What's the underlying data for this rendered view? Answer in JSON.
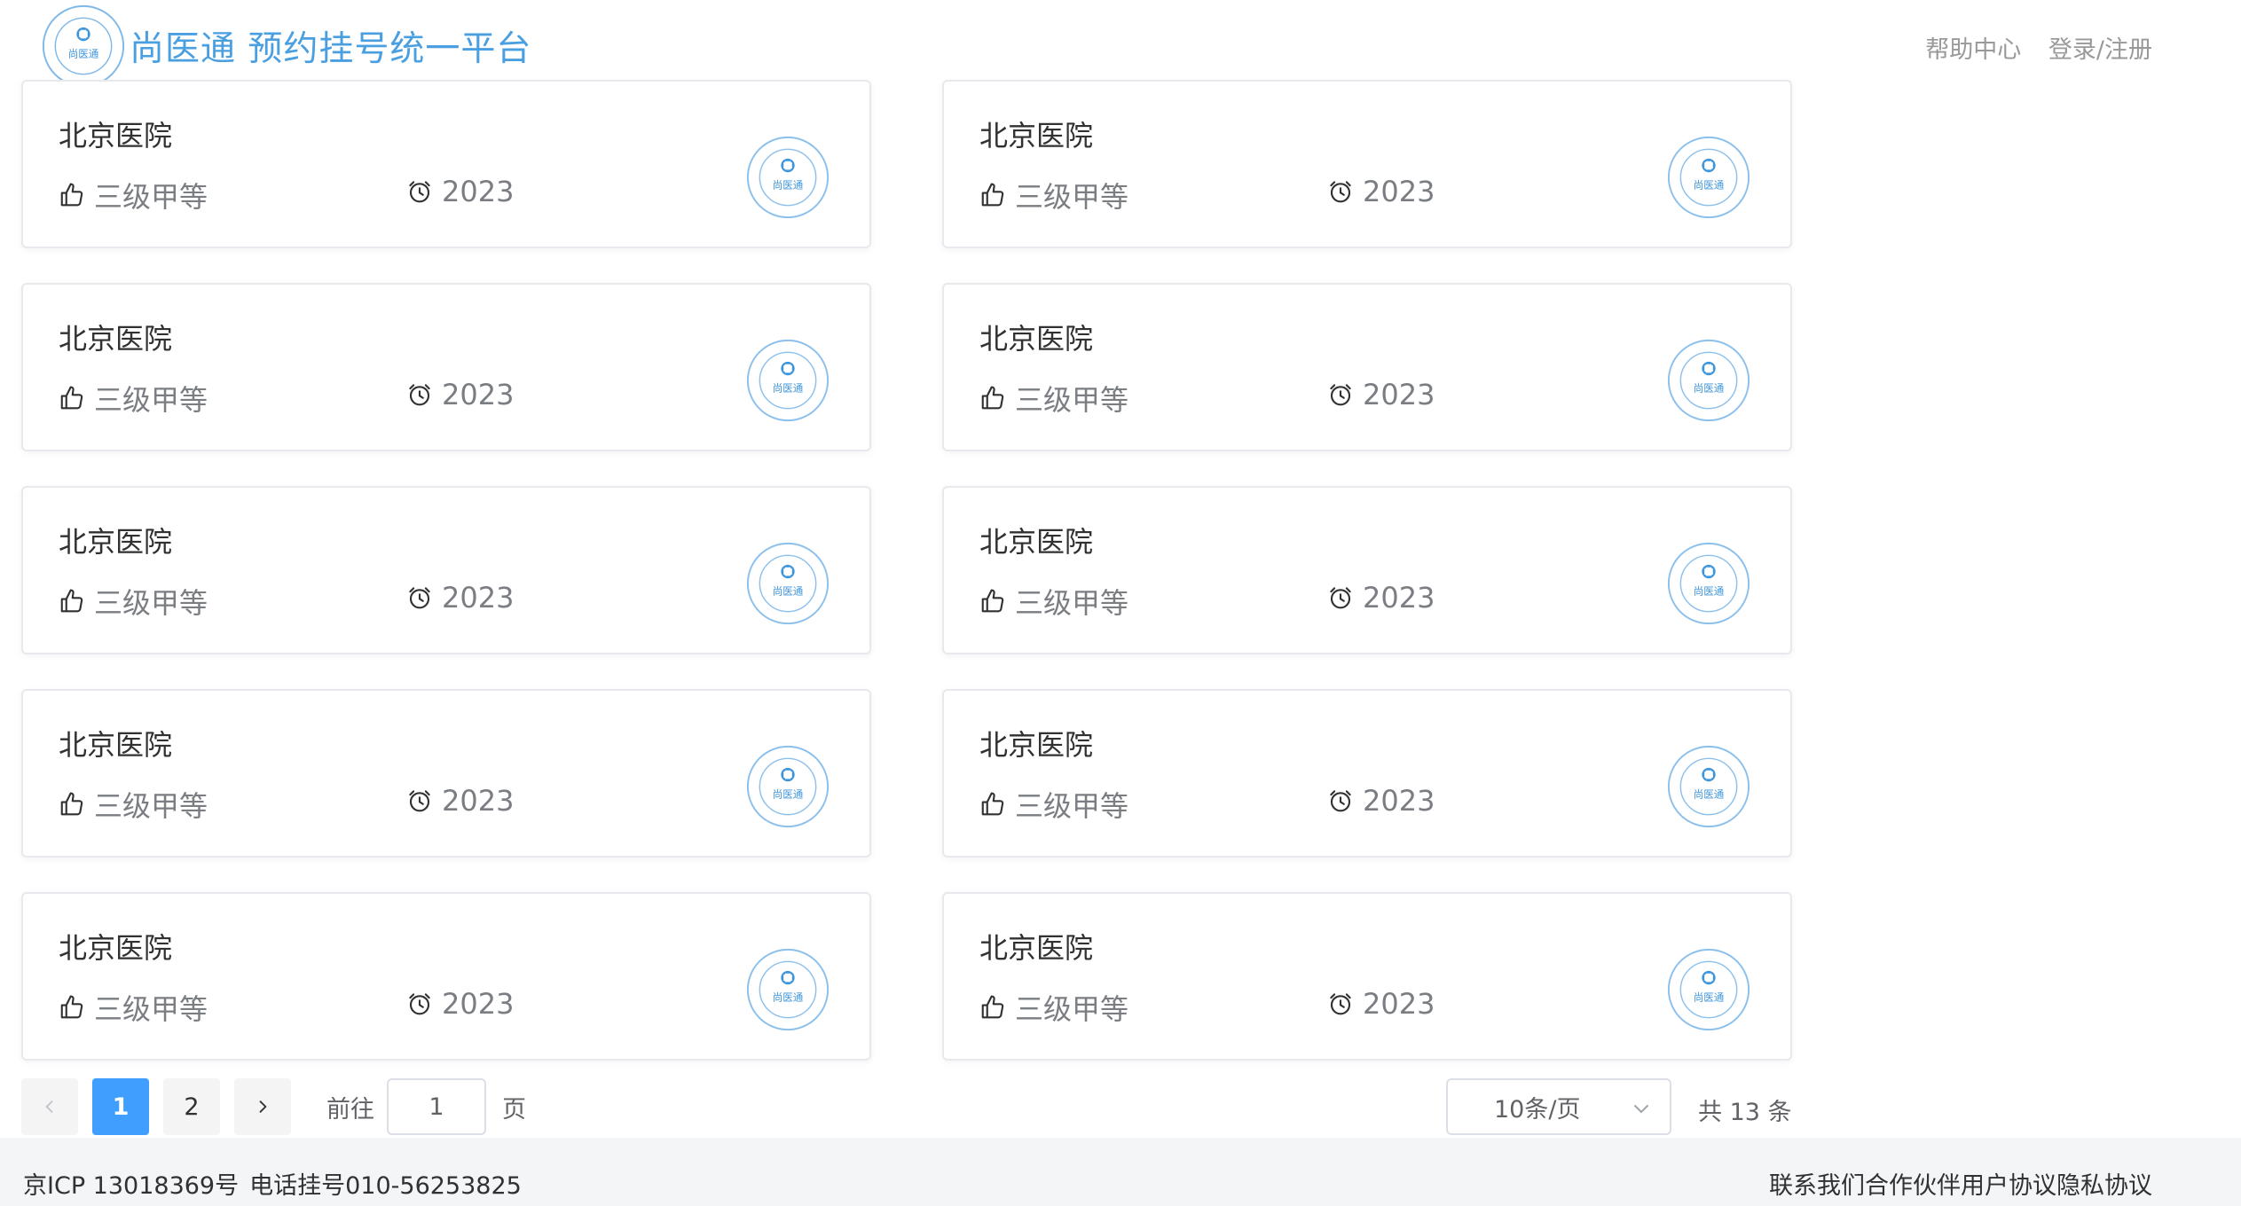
{
  "header": {
    "logo_text": "尚医通",
    "brand": "尚医通 预约挂号统一平台",
    "help": "帮助中心",
    "login": "登录/注册"
  },
  "hospitals": [
    {
      "name": "北京医院",
      "level": "三级甲等",
      "time": "2023",
      "logo_text": "尚医通"
    },
    {
      "name": "北京医院",
      "level": "三级甲等",
      "time": "2023",
      "logo_text": "尚医通"
    },
    {
      "name": "北京医院",
      "level": "三级甲等",
      "time": "2023",
      "logo_text": "尚医通"
    },
    {
      "name": "北京医院",
      "level": "三级甲等",
      "time": "2023",
      "logo_text": "尚医通"
    },
    {
      "name": "北京医院",
      "level": "三级甲等",
      "time": "2023",
      "logo_text": "尚医通"
    },
    {
      "name": "北京医院",
      "level": "三级甲等",
      "time": "2023",
      "logo_text": "尚医通"
    },
    {
      "name": "北京医院",
      "level": "三级甲等",
      "time": "2023",
      "logo_text": "尚医通"
    },
    {
      "name": "北京医院",
      "level": "三级甲等",
      "time": "2023",
      "logo_text": "尚医通"
    },
    {
      "name": "北京医院",
      "level": "三级甲等",
      "time": "2023",
      "logo_text": "尚医通"
    },
    {
      "name": "北京医院",
      "level": "三级甲等",
      "time": "2023",
      "logo_text": "尚医通"
    }
  ],
  "pagination": {
    "pages": [
      "1",
      "2"
    ],
    "current": "1",
    "goto_label": "前往",
    "goto_value": "1",
    "goto_suffix": "页",
    "page_size": "10条/页",
    "total": "共 13 条"
  },
  "footer": {
    "icp": "京ICP 13018369号",
    "phone": "电话挂号010-56253825",
    "links": [
      "联系我们",
      "合作伙伴",
      "用户协议",
      "隐私协议"
    ]
  },
  "colors": {
    "brand": "#4a9fe0",
    "active_page": "#409eff",
    "card_border": "#e7e9ee",
    "footer_bg": "#f4f5f7"
  },
  "icons": {
    "level": "thumbs-up-icon",
    "time": "alarm-clock-icon",
    "prev": "chevron-left-icon",
    "next": "chevron-right-icon",
    "dropdown": "chevron-down-icon"
  }
}
